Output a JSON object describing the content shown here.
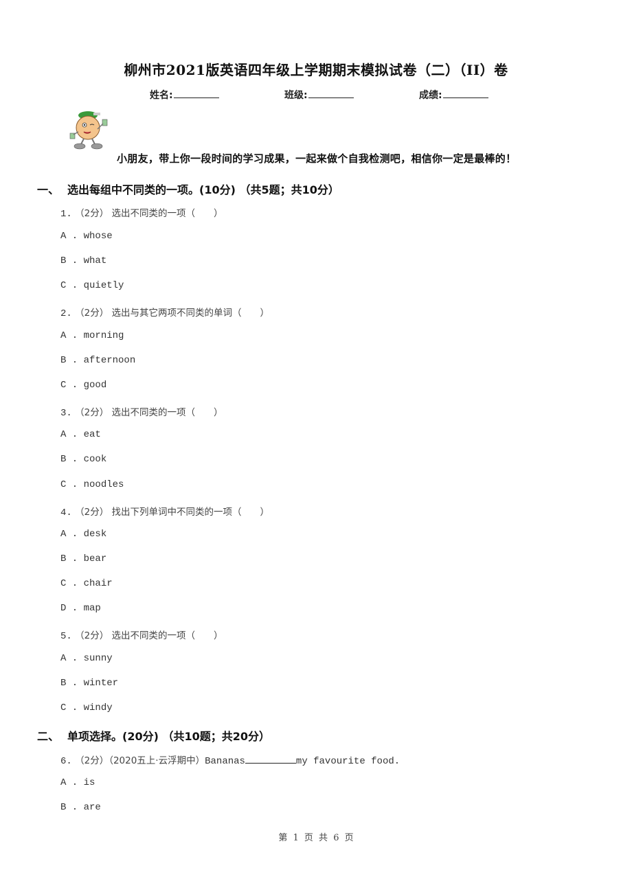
{
  "header": {
    "title": "柳州市2021版英语四年级上学期期末模拟试卷（二）（II）卷",
    "fields": [
      {
        "label": "姓名:"
      },
      {
        "label": "班级:"
      },
      {
        "label": "成绩:"
      }
    ],
    "greeting": "小朋友，带上你一段时间的学习成果，一起来做个自我检测吧，相信你一定是最棒的！"
  },
  "sections": [
    {
      "number": "一、",
      "title": "选出每组中不同类的一项。(10分) （共5题；共10分）",
      "questions": [
        {
          "number": "1.",
          "score": "（2分）",
          "prompt": "选出不同类的一项（　　）",
          "options": [
            {
              "letter": "A",
              "text": "whose"
            },
            {
              "letter": "B",
              "text": "what"
            },
            {
              "letter": "C",
              "text": "quietly"
            }
          ]
        },
        {
          "number": "2.",
          "score": "（2分）",
          "prompt": "选出与其它两项不同类的单词（　　）",
          "options": [
            {
              "letter": "A",
              "text": "morning"
            },
            {
              "letter": "B",
              "text": "afternoon"
            },
            {
              "letter": "C",
              "text": "good"
            }
          ]
        },
        {
          "number": "3.",
          "score": "（2分）",
          "prompt": "选出不同类的一项（　　）",
          "options": [
            {
              "letter": "A",
              "text": "eat"
            },
            {
              "letter": "B",
              "text": "cook"
            },
            {
              "letter": "C",
              "text": "noodles"
            }
          ]
        },
        {
          "number": "4.",
          "score": "（2分）",
          "prompt": "找出下列单词中不同类的一项（　　）",
          "options": [
            {
              "letter": "A",
              "text": "desk"
            },
            {
              "letter": "B",
              "text": "bear"
            },
            {
              "letter": "C",
              "text": "chair"
            },
            {
              "letter": "D",
              "text": "map"
            }
          ]
        },
        {
          "number": "5.",
          "score": "（2分）",
          "prompt": "选出不同类的一项（　　）",
          "options": [
            {
              "letter": "A",
              "text": "sunny"
            },
            {
              "letter": "B",
              "text": "winter"
            },
            {
              "letter": "C",
              "text": "windy"
            }
          ]
        }
      ]
    },
    {
      "number": "二、",
      "title": "单项选择。(20分) （共10题；共20分）",
      "questions": [
        {
          "number": "6.",
          "score": "（2分）",
          "source": "（2020五上·云浮期中）",
          "prompt_before": "Bananas",
          "prompt_after": "my favourite food.",
          "options": [
            {
              "letter": "A",
              "text": "is"
            },
            {
              "letter": "B",
              "text": "are"
            }
          ]
        }
      ]
    }
  ],
  "footer": {
    "page_label": "第 1 页 共 6 页"
  }
}
